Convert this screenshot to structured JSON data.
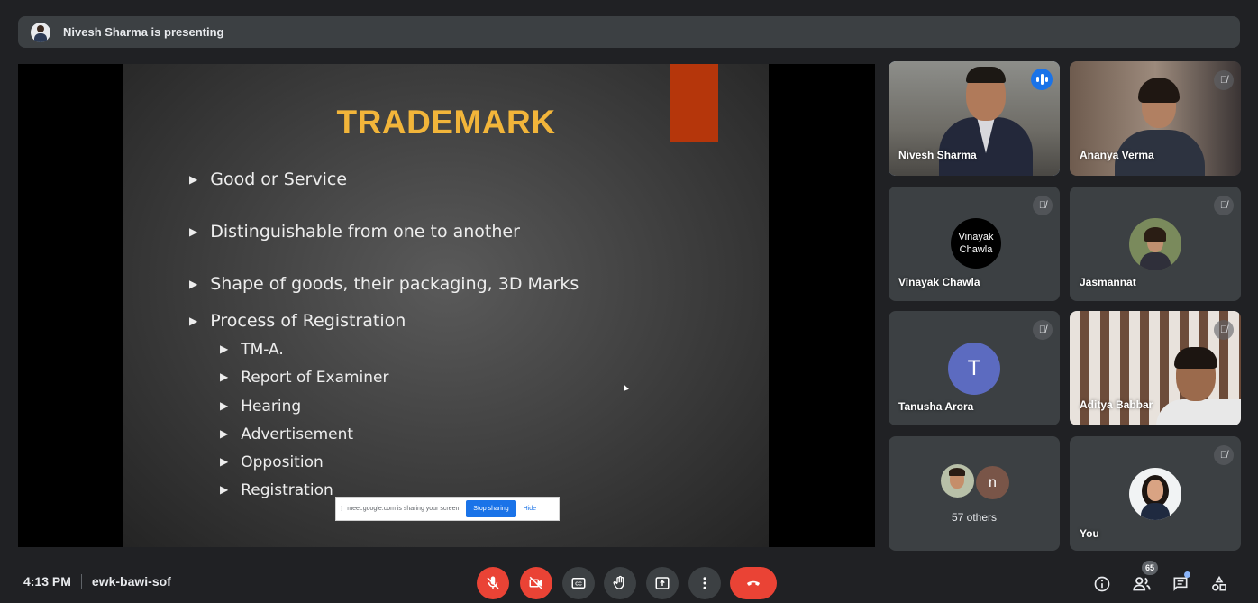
{
  "banner": {
    "text": "Nivesh Sharma is presenting"
  },
  "slide": {
    "title": "TRADEMARK",
    "bullets": [
      "Good or Service",
      "Distinguishable from one to another",
      "Shape of goods, their packaging, 3D Marks",
      "Process of Registration"
    ],
    "sub_bullets": [
      "TM-A.",
      "Report of Examiner",
      "Hearing",
      "Advertisement",
      "Opposition",
      "Registration"
    ],
    "colors": {
      "title": "#f2b53a",
      "accent_bar": "#b5360b"
    }
  },
  "share_bar": {
    "message": "meet.google.com is sharing your screen.",
    "stop_label": "Stop sharing",
    "hide_label": "Hide"
  },
  "participants": [
    {
      "name": "Nivesh Sharma",
      "state": "speaking"
    },
    {
      "name": "Ananya Verma",
      "state": "muted"
    },
    {
      "name": "Vinayak Chawla",
      "state": "muted",
      "avatar_line1": "Vinayak",
      "avatar_line2": "Chawla"
    },
    {
      "name": "Jasmannat",
      "state": "muted"
    },
    {
      "name": "Tanusha Arora",
      "state": "muted",
      "avatar_letter": "T"
    },
    {
      "name": "Aditya Babbar",
      "state": "muted"
    },
    {
      "name": "",
      "others_label": "57 others",
      "avatar_letter": "n"
    },
    {
      "name": "You",
      "state": "muted"
    }
  ],
  "meeting": {
    "time": "4:13 PM",
    "code": "ewk-bawi-sof"
  },
  "controls": [
    "mic-off",
    "camera-off",
    "captions",
    "raise-hand",
    "present-now",
    "more-options",
    "leave-call"
  ],
  "right_controls": {
    "people_count": "65"
  }
}
